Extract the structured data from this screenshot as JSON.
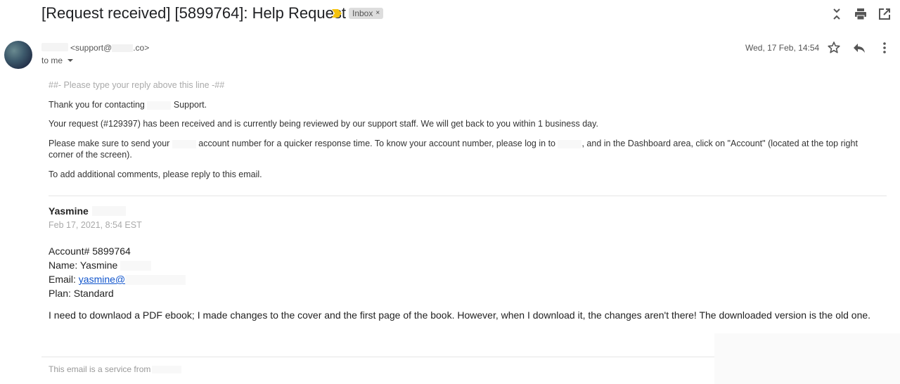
{
  "header": {
    "subject": "[Request received] [5899764]: Help Request",
    "label_chip": "Inbox",
    "chip_close": "×",
    "icons": [
      "collapse-all-icon",
      "print-icon",
      "open-in-new-window-icon"
    ],
    "important_color": "#f4c20d"
  },
  "message": {
    "sender_email": "<support@",
    "sender_email_tail": ".co>",
    "recipient": "to me",
    "date": "Wed, 17 Feb, 14:54",
    "icons": [
      "star-icon",
      "reply-icon",
      "more-vert-icon"
    ]
  },
  "body": {
    "reply_line": "##- Please type your reply above this line -##",
    "thanks_start": "Thank you for contacting",
    "thanks_end": "Support.",
    "received": "Your request (#129397) has been received and is currently being reviewed by our support staff. We will get back to you within 1 business day.",
    "account_p1": "Please make sure to send your",
    "account_p2": "account number for a quicker response time. To know your account number, please log in to",
    "account_p3": ", and in the Dashboard area, click on \"Account\" (located at the top right corner of the screen).",
    "comments": "To add additional comments, please reply to this email."
  },
  "customer_message": {
    "author": "Yasmine",
    "timestamp": "Feb 17, 2021, 8:54 EST",
    "account": "Account# 5899764",
    "name_label": "Name:",
    "name_value": "Yasmine",
    "email_label": "Email:",
    "email_value": "yasmine@",
    "plan": "Plan: Standard",
    "request": "I need to downlaod a PDF ebook; I made changes to the cover and the first page of the book. However, when I download it, the changes aren't there! The downloaded version is the old one."
  },
  "footer": {
    "text": "This email is a service from"
  },
  "colors": {
    "link": "#1155cc",
    "muted": "#aaaaaa",
    "chip_bg": "#dddddd"
  }
}
